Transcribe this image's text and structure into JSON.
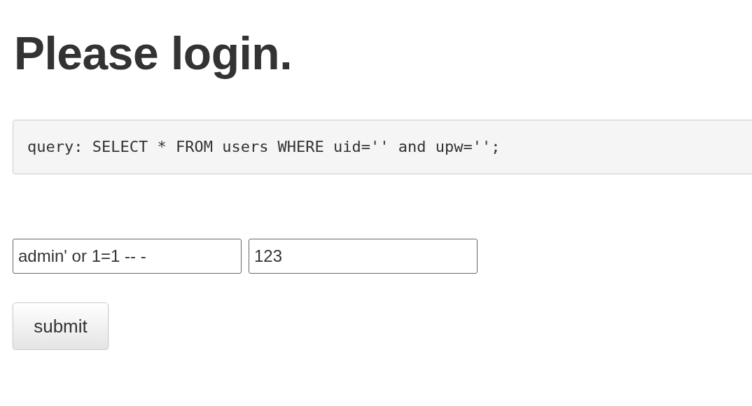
{
  "heading": "Please login.",
  "query": "query: SELECT * FROM users WHERE uid='' and upw='';",
  "fields": [
    {
      "value": "admin' or 1=1 -- -"
    },
    {
      "value": "123"
    }
  ],
  "submit": "submit"
}
